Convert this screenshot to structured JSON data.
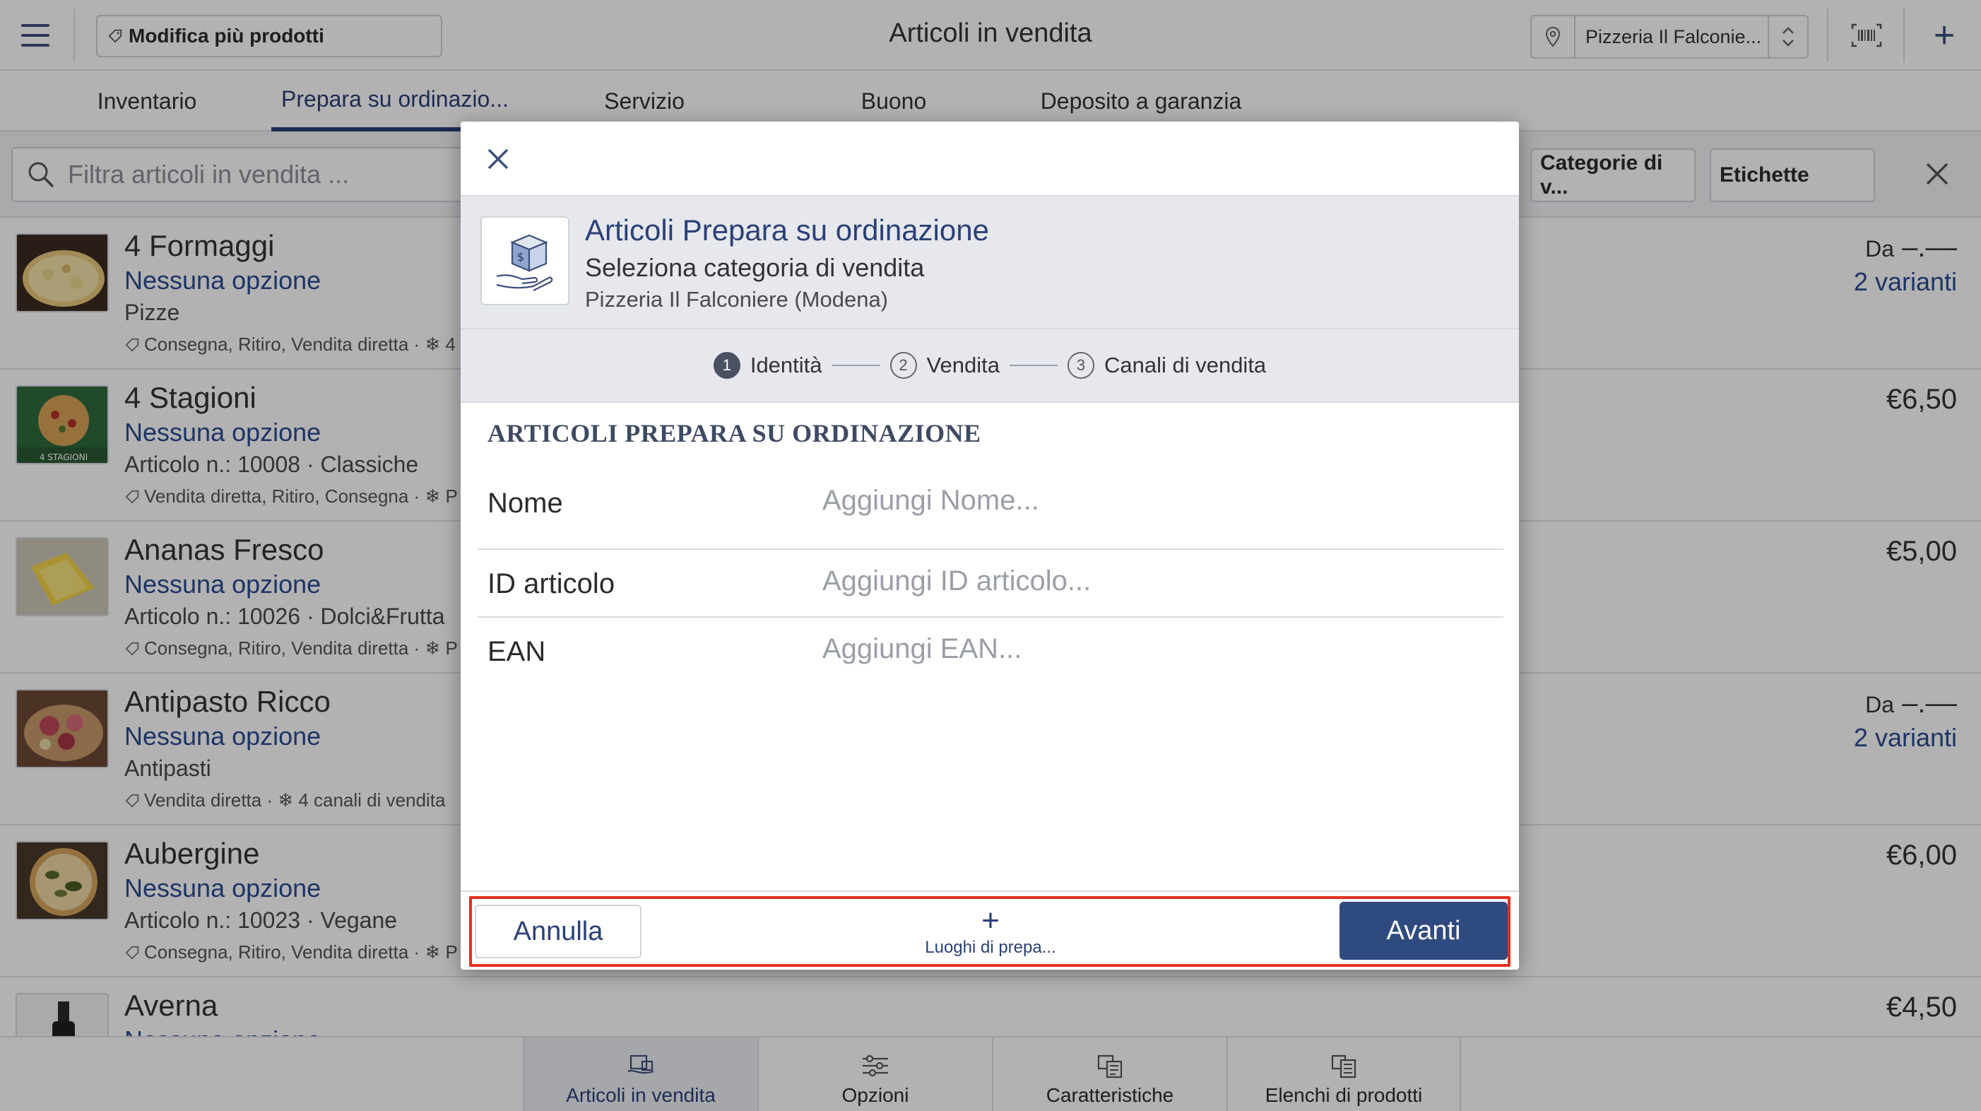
{
  "app": {
    "title": "Articoli in vendita",
    "edit_multi_label": "Modifica più prodotti",
    "store_selector": "Pizzeria Il Falconie..."
  },
  "tabs": [
    {
      "label": "Inventario"
    },
    {
      "label": "Prepara su ordinazio..."
    },
    {
      "label": "Servizio"
    },
    {
      "label": "Buono"
    },
    {
      "label": "Deposito a garanzia"
    }
  ],
  "filter": {
    "placeholder": "Filtra articoli in vendita  ...",
    "chip_categories": "Categorie di v...",
    "chip_labels": "Etichette"
  },
  "items": [
    {
      "name": "4 Formaggi",
      "option": "Nessuna opzione",
      "sub": "Pizze",
      "channels": "Consegna, Ritiro, Vendita diretta · ❄ 4",
      "price_prefix": "Da",
      "price": "–.––",
      "variants": "2 varianti"
    },
    {
      "name": "4 Stagioni",
      "option": "Nessuna opzione",
      "sub": "Articolo n.: 10008 · Classiche",
      "channels": "Vendita diretta, Ritiro, Consegna · ❄ P",
      "price_prefix": "",
      "price": "€6,50",
      "variants": ""
    },
    {
      "name": "Ananas Fresco",
      "option": "Nessuna opzione",
      "sub": "Articolo n.: 10026 · Dolci&Frutta",
      "channels": "Consegna, Ritiro, Vendita diretta · ❄ P",
      "price_prefix": "",
      "price": "€5,00",
      "variants": ""
    },
    {
      "name": "Antipasto Ricco",
      "option": "Nessuna opzione",
      "sub": "Antipasti",
      "channels": "Vendita diretta · ❄ 4 canali di vendita",
      "price_prefix": "Da",
      "price": "–.––",
      "variants": "2 varianti"
    },
    {
      "name": "Aubergine",
      "option": "Nessuna opzione",
      "sub": "Articolo n.: 10023 · Vegane",
      "channels": "Consegna, Ritiro, Vendita diretta · ❄ P",
      "price_prefix": "",
      "price": "€6,00",
      "variants": ""
    },
    {
      "name": "Averna",
      "option": "Nessuna opzione",
      "sub": "",
      "channels": "",
      "price_prefix": "",
      "price": "€4,50",
      "variants": ""
    }
  ],
  "bottom_nav": [
    {
      "label": "Articoli in vendita"
    },
    {
      "label": "Opzioni"
    },
    {
      "label": "Caratteristiche"
    },
    {
      "label": "Elenchi di prodotti"
    }
  ],
  "modal": {
    "title": "Articoli Prepara su ordinazione",
    "subtitle": "Seleziona categoria di vendita",
    "store": "Pizzeria Il Falconiere (Modena)",
    "steps": [
      {
        "num": "1",
        "label": "Identità"
      },
      {
        "num": "2",
        "label": "Vendita"
      },
      {
        "num": "3",
        "label": "Canali di vendita"
      }
    ],
    "section_title": "ARTICOLI PREPARA SU ORDINAZIONE",
    "fields": {
      "name": {
        "label": "Nome",
        "placeholder": "Aggiungi Nome..."
      },
      "item_id": {
        "label": "ID articolo",
        "placeholder": "Aggiungi ID articolo..."
      },
      "ean": {
        "label": "EAN",
        "placeholder": "Aggiungi EAN..."
      }
    },
    "footer": {
      "cancel": "Annulla",
      "places": "Luoghi di prepa...",
      "next": "Avanti"
    }
  },
  "colors": {
    "accent": "#2b4077",
    "link": "#2b4a92",
    "highlight_border": "#e0301e",
    "primary_button": "#2f4a7f"
  }
}
